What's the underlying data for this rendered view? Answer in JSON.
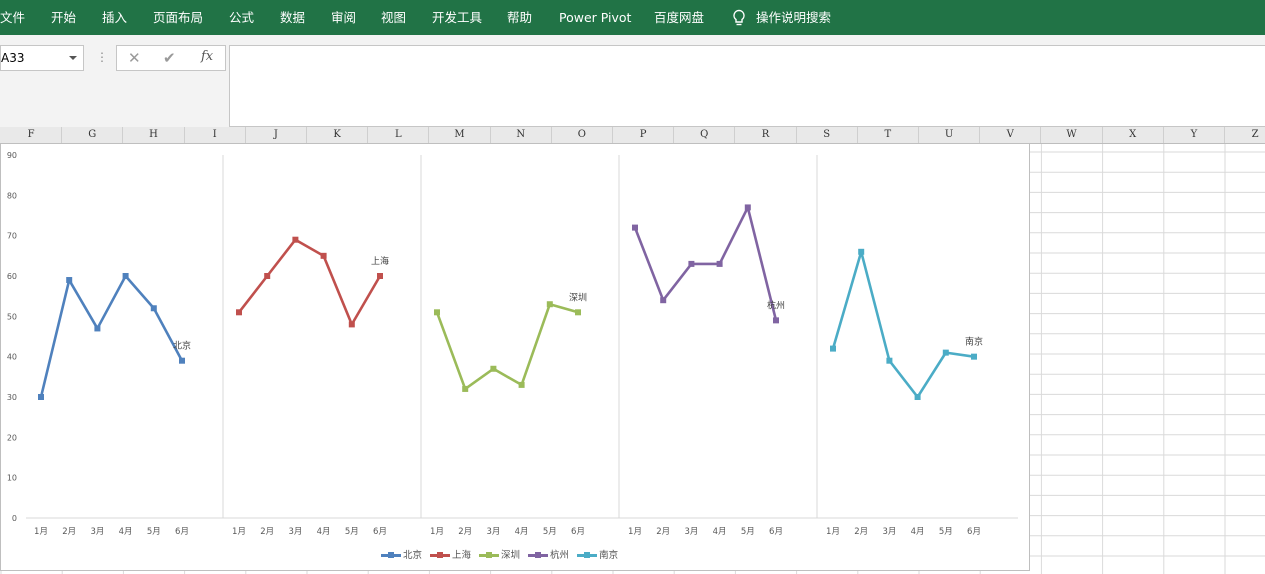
{
  "ribbon": {
    "tabs": [
      "文件",
      "开始",
      "插入",
      "页面布局",
      "公式",
      "数据",
      "审阅",
      "视图",
      "开发工具",
      "帮助",
      "Power Pivot",
      "百度网盘"
    ],
    "tell_me": "操作说明搜索",
    "tell_me_icon": "lightbulb-icon"
  },
  "formula_bar": {
    "name_box": "A33",
    "cancel_icon": "✕",
    "enter_icon": "✔",
    "fx_label": "fx",
    "formula": ""
  },
  "sheet": {
    "columns": [
      "F",
      "G",
      "H",
      "I",
      "J",
      "K",
      "L",
      "M",
      "N",
      "O",
      "P",
      "Q",
      "R",
      "S",
      "T",
      "U",
      "V",
      "W",
      "X",
      "Y",
      "Z"
    ]
  },
  "colors": {
    "ribbon": "#217346",
    "北京": "#4f81bd",
    "上海": "#c0504d",
    "深圳": "#9bbb59",
    "杭州": "#8064a2",
    "南京": "#4bacc6"
  },
  "chart_data": {
    "type": "line",
    "layout": "panel",
    "ylim": [
      0,
      90
    ],
    "yticks": [
      "0",
      "10",
      "20",
      "30",
      "40",
      "50",
      "60",
      "70",
      "80",
      "90"
    ],
    "categories": [
      "1月",
      "2月",
      "3月",
      "4月",
      "5月",
      "6月"
    ],
    "grid": false,
    "legend": "bottom",
    "series": [
      {
        "name": "北京",
        "values": [
          30,
          59,
          47,
          60,
          52,
          39
        ]
      },
      {
        "name": "上海",
        "values": [
          51,
          60,
          69,
          65,
          48,
          60
        ]
      },
      {
        "name": "深圳",
        "values": [
          51,
          32,
          37,
          33,
          53,
          51
        ]
      },
      {
        "name": "杭州",
        "values": [
          72,
          54,
          63,
          63,
          77,
          49
        ]
      },
      {
        "name": "南京",
        "values": [
          42,
          66,
          39,
          30,
          41,
          40
        ]
      }
    ]
  }
}
